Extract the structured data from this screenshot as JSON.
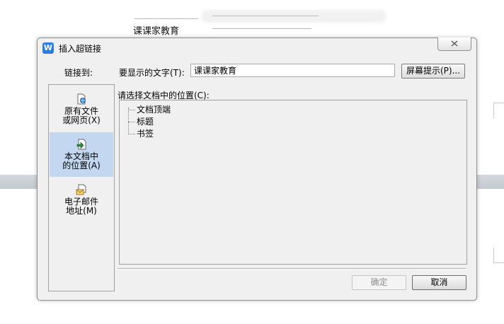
{
  "background": {
    "doc_text": "课课家教育"
  },
  "dialog": {
    "title": "插入超链接",
    "app_icon_letter": "W",
    "link_to_label": "链接到:",
    "display_text_label": "要显示的文字(T):",
    "display_text_value": "课课家教育",
    "screentip_label": "屏幕提示(P)...",
    "nav": [
      {
        "label_line1": "原有文件",
        "label_line2": "或网页(X)",
        "icon": "web-page-icon",
        "selected": false
      },
      {
        "label_line1": "本文档中",
        "label_line2": "的位置(A)",
        "icon": "document-place-icon",
        "selected": true
      },
      {
        "label_line1": "电子邮件",
        "label_line2": "地址(M)",
        "icon": "email-icon",
        "selected": false
      }
    ],
    "choose_place_label": "请选择文档中的位置(C):",
    "tree_items": [
      "文档顶端",
      "标题",
      "书签"
    ],
    "ok_label": "确定",
    "cancel_label": "取消"
  }
}
